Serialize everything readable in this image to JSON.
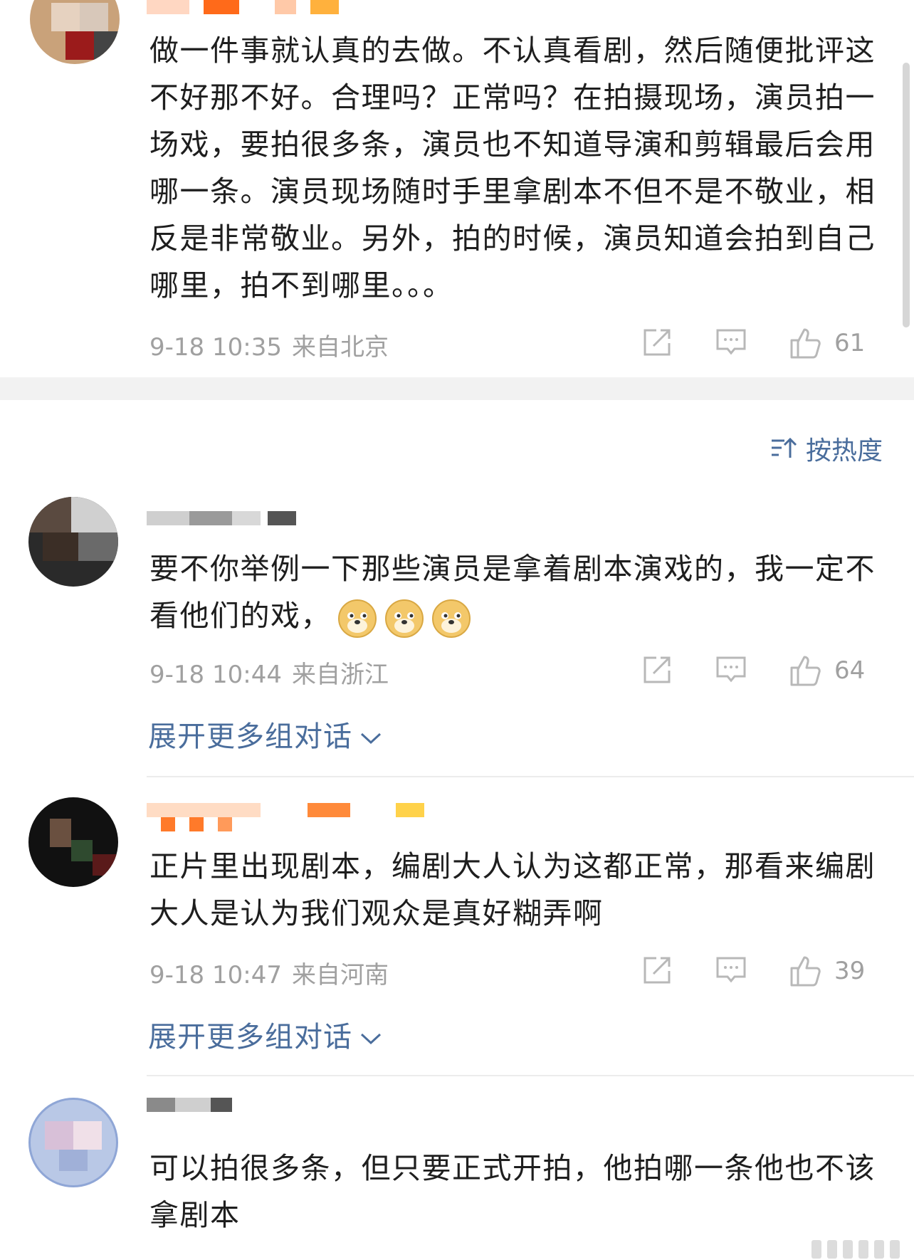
{
  "sort": {
    "label": "按热度"
  },
  "expand_label": "展开更多组对话",
  "comments": [
    {
      "text": "做一件事就认真的去做。不认真看剧，然后随便批评这不好那不好。合理吗？正常吗？在拍摄现场，演员拍一场戏，要拍很多条，演员也不知道导演和剪辑最后会用哪一条。演员现场随时手里拿剧本不但不是不敬业，相反是非常敬业。另外，拍的时候，演员知道会拍到自己哪里，拍不到哪里。。。",
      "time": "9-18 10:35",
      "location": "来自北京",
      "likes": "61"
    },
    {
      "text": "要不你举例一下那些演员是拿着剧本演戏的，我一定不看他们的戏，",
      "time": "9-18 10:44",
      "location": "来自浙江",
      "likes": "64",
      "emoji_icon": "doge-emoji"
    },
    {
      "text": "正片里出现剧本，编剧大人认为这都正常，那看来编剧大人是认为我们观众是真好糊弄啊",
      "time": "9-18 10:47",
      "location": "来自河南",
      "likes": "39"
    },
    {
      "text": "可以拍很多条，但只要正式开拍，他拍哪一条他也不该拿剧本"
    }
  ],
  "colors": {
    "link_blue": "#4a6d9c",
    "meta_gray": "#a0a0a0",
    "band_gray": "#f2f2f2"
  }
}
